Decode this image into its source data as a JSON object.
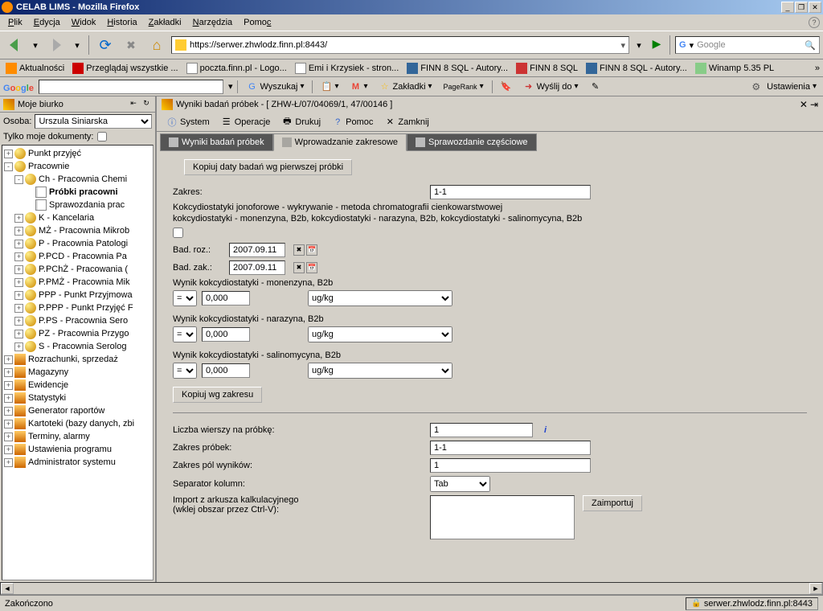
{
  "window": {
    "title": "CELAB LIMS - Mozilla Firefox"
  },
  "menubar": {
    "items": [
      "Plik",
      "Edycja",
      "Widok",
      "Historia",
      "Zakładki",
      "Narzędzia",
      "Pomoc"
    ]
  },
  "urlbar": {
    "url": "https://serwer.zhwlodz.finn.pl:8443/"
  },
  "searchbar": {
    "placeholder": "Google"
  },
  "bookmarks": [
    {
      "label": "Aktualności"
    },
    {
      "label": "Przeglądaj wszystkie ..."
    },
    {
      "label": "poczta.finn.pl - Logo..."
    },
    {
      "label": "Emi i Krzysiek - stron..."
    },
    {
      "label": "FINN 8 SQL - Autory..."
    },
    {
      "label": "FINN 8 SQL"
    },
    {
      "label": "FINN 8 SQL - Autory..."
    },
    {
      "label": "Winamp 5.35 PL"
    }
  ],
  "googlebar": {
    "wyszukaj": "Wyszukaj",
    "zakladki": "Zakładki",
    "pagerank": "PageRank",
    "wyslij": "Wyślij do",
    "ustawienia": "Ustawienia"
  },
  "sidebar": {
    "title": "Moje biurko",
    "osoba_label": "Osoba:",
    "osoba_value": "Urszula Siniarska",
    "tylko_label": "Tylko moje dokumenty:",
    "tree": [
      {
        "indent": 0,
        "toggle": "+",
        "icon": "ball",
        "label": "Punkt przyjęć"
      },
      {
        "indent": 0,
        "toggle": "-",
        "icon": "ball",
        "label": "Pracownie"
      },
      {
        "indent": 1,
        "toggle": "-",
        "icon": "ball",
        "label": "Ch - Pracownia Chemi"
      },
      {
        "indent": 2,
        "toggle": "",
        "icon": "doc",
        "label": "Próbki pracowni",
        "bold": true
      },
      {
        "indent": 2,
        "toggle": "",
        "icon": "doc",
        "label": "Sprawozdania prac"
      },
      {
        "indent": 1,
        "toggle": "+",
        "icon": "ball",
        "label": "K - Kancelaria"
      },
      {
        "indent": 1,
        "toggle": "+",
        "icon": "ball",
        "label": "MŻ - Pracownia Mikrob"
      },
      {
        "indent": 1,
        "toggle": "+",
        "icon": "ball",
        "label": "P - Pracownia Patologi"
      },
      {
        "indent": 1,
        "toggle": "+",
        "icon": "ball",
        "label": "P.PCD - Pracownia Pa"
      },
      {
        "indent": 1,
        "toggle": "+",
        "icon": "ball",
        "label": "P.PChŻ - Pracowania ("
      },
      {
        "indent": 1,
        "toggle": "+",
        "icon": "ball",
        "label": "P.PMŻ - Pracownia Mik"
      },
      {
        "indent": 1,
        "toggle": "+",
        "icon": "ball",
        "label": "PPP - Punkt Przyjmowa"
      },
      {
        "indent": 1,
        "toggle": "+",
        "icon": "ball",
        "label": "P.PPP - Punkt Przyjęć F"
      },
      {
        "indent": 1,
        "toggle": "+",
        "icon": "ball",
        "label": "P.PS - Pracownia Sero"
      },
      {
        "indent": 1,
        "toggle": "+",
        "icon": "ball",
        "label": "PZ - Pracownia Przygo"
      },
      {
        "indent": 1,
        "toggle": "+",
        "icon": "ball",
        "label": "S - Pracownia Serolog"
      },
      {
        "indent": 0,
        "toggle": "+",
        "icon": "gen",
        "label": "Rozrachunki, sprzedaż"
      },
      {
        "indent": 0,
        "toggle": "+",
        "icon": "gen",
        "label": "Magazyny"
      },
      {
        "indent": 0,
        "toggle": "+",
        "icon": "gen",
        "label": "Ewidencje"
      },
      {
        "indent": 0,
        "toggle": "+",
        "icon": "gen",
        "label": "Statystyki"
      },
      {
        "indent": 0,
        "toggle": "+",
        "icon": "gen",
        "label": "Generator raportów"
      },
      {
        "indent": 0,
        "toggle": "+",
        "icon": "gen",
        "label": "Kartoteki (bazy danych, zbi"
      },
      {
        "indent": 0,
        "toggle": "+",
        "icon": "gen",
        "label": "Terminy, alarmy"
      },
      {
        "indent": 0,
        "toggle": "+",
        "icon": "gen",
        "label": "Ustawienia programu"
      },
      {
        "indent": 0,
        "toggle": "+",
        "icon": "gen",
        "label": "Administrator systemu"
      }
    ]
  },
  "content": {
    "header": "Wyniki badań próbek - [ ZHW-Ł/07/04069/1, 47/00146 ]",
    "toolbar": {
      "system": "System",
      "operacje": "Operacje",
      "drukuj": "Drukuj",
      "pomoc": "Pomoc",
      "zamknij": "Zamknij"
    },
    "tabs": {
      "t1": "Wyniki badań próbek",
      "t2": "Wprowadzanie zakresowe",
      "t3": "Sprawozdanie częściowe"
    },
    "form": {
      "kopiuj_daty": "Kopiuj daty badań wg pierwszej próbki",
      "zakres_label": "Zakres:",
      "zakres_value": "1-1",
      "desc1": "Kokcydiostatyki jonoforowe - wykrywanie - metoda chromatografii cienkowarstwowej",
      "desc2": "kokcydiostatyki - monenzyna, B2b, kokcydiostatyki - narazyna, B2b, kokcydiostatyki - salinomycyna, B2b",
      "bad_roz_label": "Bad. roz.:",
      "bad_roz_value": "2007.09.11",
      "bad_zak_label": "Bad. zak.:",
      "bad_zak_value": "2007.09.11",
      "wynik1_label": "Wynik kokcydiostatyki - monenzyna, B2b",
      "wynik2_label": "Wynik kokcydiostatyki - narazyna, B2b",
      "wynik3_label": "Wynik kokcydiostatyki - salinomycyna, B2b",
      "op_value": "=",
      "num_value": "0,000",
      "unit_value": "ug/kg",
      "kopiuj_zakres": "Kopiuj wg zakresu",
      "liczba_label": "Liczba wierszy na próbkę:",
      "liczba_value": "1",
      "zakres_probek_label": "Zakres próbek:",
      "zakres_probek_value": "1-1",
      "zakres_pol_label": "Zakres pól wyników:",
      "zakres_pol_value": "1",
      "separator_label": "Separator kolumn:",
      "separator_value": "Tab",
      "import_label": "Import z arkusza kalkulacyjnego",
      "import_sub": "(wklej obszar przez Ctrl-V):",
      "zaimportuj": "Zaimportuj"
    }
  },
  "statusbar": {
    "left": "Zakończono",
    "right": "serwer.zhwlodz.finn.pl:8443"
  }
}
